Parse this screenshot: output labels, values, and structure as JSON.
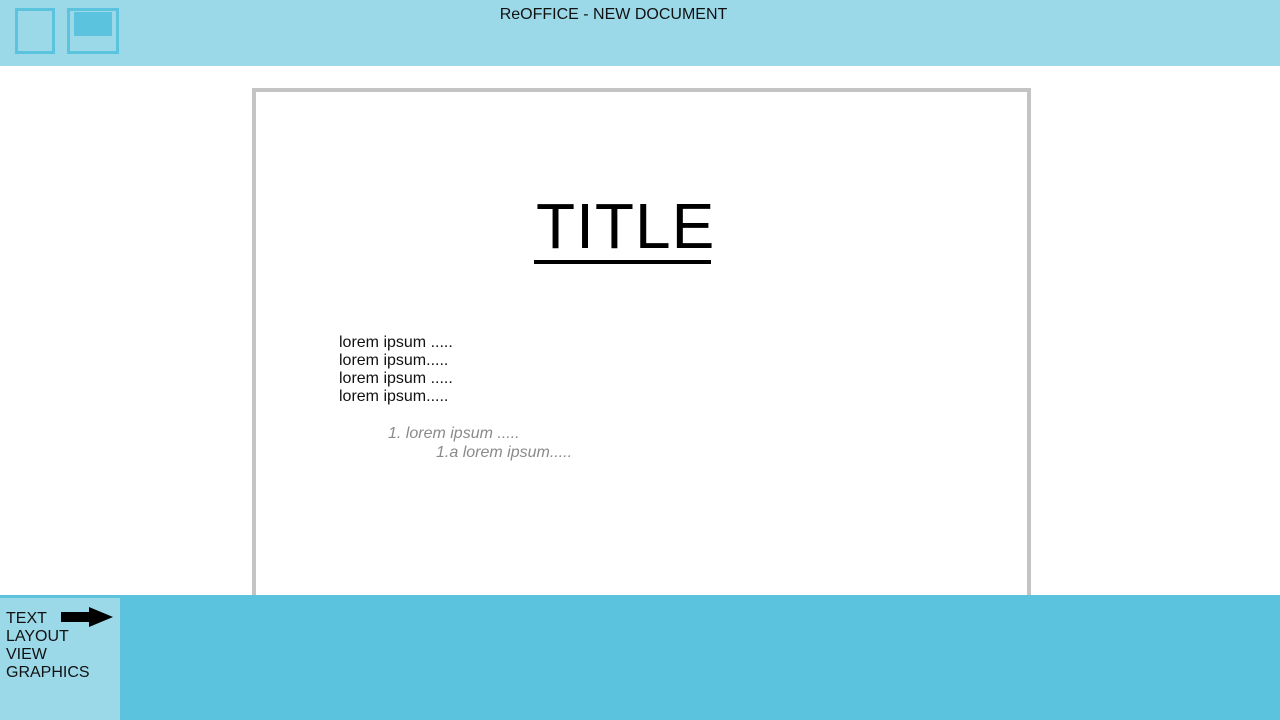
{
  "window": {
    "title": "ReOFFICE - NEW DOCUMENT"
  },
  "toolbar": {
    "buttons": [
      {
        "icon": "new-document-icon"
      },
      {
        "icon": "save-icon"
      }
    ]
  },
  "document": {
    "title": "TITLE",
    "lines": [
      "lorem ipsum .....",
      "lorem ipsum.....",
      "lorem ipsum .....",
      "lorem ipsum....."
    ],
    "list": [
      {
        "label": "1. lorem ipsum ....."
      },
      {
        "label": "1.a lorem ipsum....."
      }
    ]
  },
  "menu": {
    "items": [
      {
        "label": "TEXT",
        "active": true
      },
      {
        "label": "LAYOUT"
      },
      {
        "label": "VIEW"
      },
      {
        "label": "GRAPHICS"
      }
    ],
    "active_indicator": "arrow-right-icon"
  },
  "colors": {
    "topbar": "#9bd9e9",
    "bottombar": "#5bc3dd",
    "accent": "#5bc3dd",
    "page_border": "#c4c4c4",
    "list_text": "#8a8a8a"
  }
}
